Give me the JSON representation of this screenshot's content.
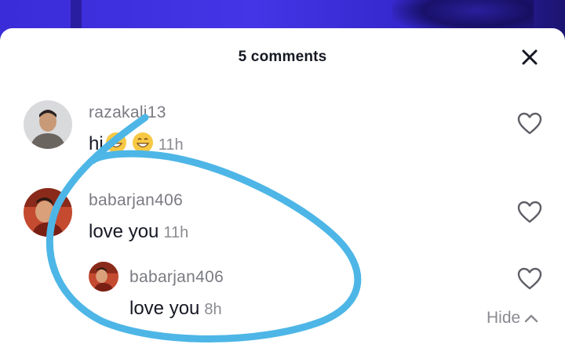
{
  "header": {
    "title": "5 comments"
  },
  "comments": [
    {
      "username": "razakali13",
      "text": "hi",
      "emojis": [
        "grinning-face-icon",
        "grinning-face-icon"
      ],
      "time": "11h"
    },
    {
      "username": "babarjan406",
      "text": "love you",
      "time": "11h"
    },
    {
      "username": "babarjan406",
      "text": "love you",
      "time": "8h",
      "is_reply": true
    }
  ],
  "footer": {
    "hide_label": "Hide"
  },
  "colors": {
    "annotation": "#4db6e6",
    "text": "#161823",
    "muted": "#8a8b91"
  }
}
